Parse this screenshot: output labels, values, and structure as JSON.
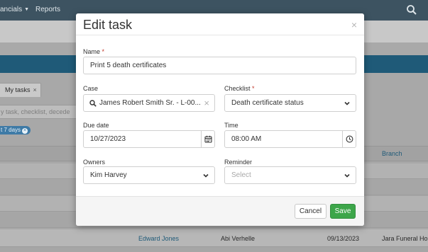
{
  "app": {
    "nav": {
      "financials": "ancials",
      "reports": "Reports"
    },
    "tab": {
      "label": "My tasks",
      "close": "×"
    },
    "search_placeholder": "y task, checklist, decede",
    "chip": {
      "label": "t 7 days",
      "close": "×"
    },
    "table": {
      "header_branch": "Branch",
      "last_row": {
        "name": "Edward Jones",
        "assignee": "Abi Verhelle",
        "date": "09/13/2023",
        "branch": "Jara Funeral Hom"
      }
    }
  },
  "modal": {
    "title": "Edit task",
    "close": "×",
    "required_mark": "*",
    "name": {
      "label": "Name",
      "value": "Print 5 death certificates"
    },
    "case": {
      "label": "Case",
      "value": "James Robert Smith Sr. - L-00...",
      "clear": "×"
    },
    "checklist": {
      "label": "Checklist",
      "value": "Death certificate status"
    },
    "due_date": {
      "label": "Due date",
      "value": "10/27/2023"
    },
    "time": {
      "label": "Time",
      "value": "08:00 AM"
    },
    "owners": {
      "label": "Owners",
      "value": "Kim Harvey"
    },
    "reminder": {
      "label": "Reminder",
      "placeholder": "Select"
    },
    "buttons": {
      "cancel": "Cancel",
      "save": "Save"
    }
  },
  "colors": {
    "topbar": "#3d5361",
    "accent_blue": "#1f5a78",
    "save_green": "#3da64a",
    "required_red": "#c0392b"
  },
  "icons": [
    "search-icon",
    "close-icon",
    "chevron-down-icon",
    "calendar-icon",
    "clock-icon"
  ]
}
